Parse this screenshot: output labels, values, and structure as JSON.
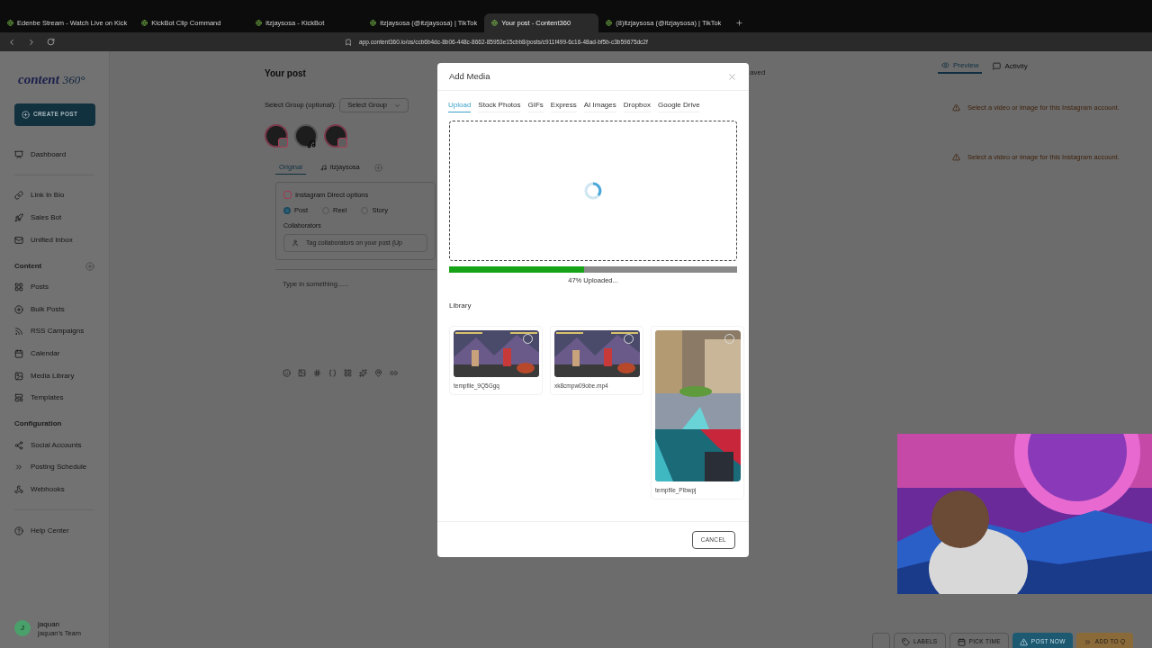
{
  "browser": {
    "tabs": [
      {
        "title": "Edenbe Stream - Watch Live on Kick",
        "selected": false
      },
      {
        "title": "KickBot Clip Command",
        "selected": false
      },
      {
        "title": "itzjaysosa - KickBot",
        "selected": false
      },
      {
        "title": "itzjaysosa (@itzjaysosa) | TikTok",
        "selected": false
      },
      {
        "title": "Your post - Content360",
        "selected": true
      },
      {
        "title": "(8)itzjaysosa (@itzjaysosa) | TikTok",
        "selected": false
      }
    ],
    "url": "app.content360.io/os/ccb6b4dc-8b06-448c-8662-85953e15cbb8/posts/c911f499-6c16-48ad-bf5b-c3b59675dc2f"
  },
  "sidebar": {
    "logo": "content",
    "logo_suffix": "360°",
    "create_button": "CREATE POST",
    "sections": [
      {
        "items": [
          "Dashboard"
        ]
      },
      {
        "items": [
          "Link In Bio",
          "Sales Bot",
          "Unified Inbox"
        ]
      },
      {
        "header": "Content",
        "items": [
          "Posts",
          "Bulk Posts",
          "RSS Campaigns",
          "Calendar",
          "Media Library",
          "Templates"
        ]
      },
      {
        "header": "Configuration",
        "items": [
          "Social Accounts",
          "Posting Schedule",
          "Webhooks"
        ]
      },
      {
        "items": [
          "Help Center"
        ]
      }
    ],
    "user": {
      "initial": "J",
      "name": "jaquan",
      "team": "jaquan's Team"
    }
  },
  "editor": {
    "title": "Your post",
    "group_label": "Select Group (optional):",
    "group_select": "Select Group",
    "accounts": [
      {
        "kind": "instagram"
      },
      {
        "kind": "tiktok"
      },
      {
        "kind": "instagram"
      }
    ],
    "tabs": [
      {
        "label": "Original",
        "selected": true
      },
      {
        "label": "itzjaysosa",
        "selected": false
      }
    ],
    "options_title": "Instagram Direct options",
    "post_types": [
      {
        "label": "Post",
        "selected": true
      },
      {
        "label": "Reel",
        "selected": false
      },
      {
        "label": "Story",
        "selected": false
      }
    ],
    "collaborators_label": "Collaborators",
    "collaborators_placeholder": "Tag collaborators on your post (Up",
    "text_placeholder": "Type in something......"
  },
  "saved": "aved",
  "preview": {
    "tabs": [
      {
        "label": "Preview",
        "selected": true
      },
      {
        "label": "Activity",
        "selected": false
      }
    ],
    "warnings": [
      "Select a video or image for this Instagram account.",
      "Select a video or image for this Instagram account."
    ]
  },
  "actions": [
    "LABELS",
    "PICK TIME",
    "POST NOW",
    "ADD TO Q"
  ],
  "modal": {
    "title": "Add Media",
    "tabs": [
      {
        "label": "Upload",
        "selected": true
      },
      {
        "label": "Stock Photos",
        "selected": false
      },
      {
        "label": "GIFs",
        "selected": false
      },
      {
        "label": "Express",
        "selected": false
      },
      {
        "label": "AI Images",
        "selected": false
      },
      {
        "label": "Dropbox",
        "selected": false
      },
      {
        "label": "Google Drive",
        "selected": false
      }
    ],
    "upload": {
      "level": 0.47,
      "status": "47% Uploaded..."
    },
    "library_title": "Library",
    "library": [
      {
        "name": "tempfile_9Q5Ggq",
        "kind": "landscape"
      },
      {
        "name": "xk8cmpw09obe.mp4",
        "kind": "landscape"
      },
      {
        "name": "tempfile_Plbwpj",
        "kind": "portrait"
      }
    ],
    "cancel": "CANCEL"
  }
}
